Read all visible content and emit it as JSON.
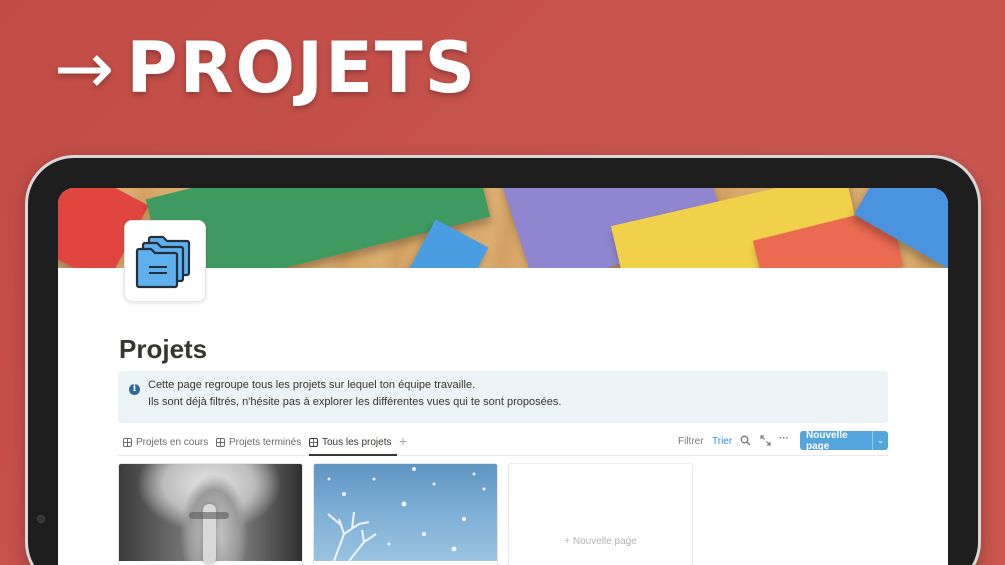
{
  "banner": {
    "arrow": "→",
    "title": "PROJETS"
  },
  "page": {
    "title": "Projets",
    "icon": "folders-icon"
  },
  "callout": {
    "icon": "info-icon",
    "line1": "Cette page regroupe tous les projets sur lequel ton équipe travaille.",
    "line2": "Ils sont déjà filtrés, n'hésite pas à explorer les différentes vues qui te sont proposées."
  },
  "views": {
    "tabs": [
      {
        "label": "Projets en cours",
        "active": false
      },
      {
        "label": "Projets terminés",
        "active": false
      },
      {
        "label": "Tous les projets",
        "active": true
      }
    ],
    "add": "+"
  },
  "toolbar": {
    "filter": "Filtrer",
    "sort": "Trier",
    "search_icon": "search-icon",
    "expand_icon": "expand-icon",
    "more": "···",
    "new_page": "Nouvelle page",
    "new_page_chevron": "⌄"
  },
  "gallery": {
    "cards": [
      {
        "image": "person-finger-on-lips-photo"
      },
      {
        "image": "snowy-tree-blue-sky-photo"
      }
    ],
    "add_card": {
      "icon": "+",
      "label": "Nouvelle page"
    }
  },
  "colors": {
    "background": "#c24b45",
    "accent": "#53a5dc",
    "callout": "#ecf3f6"
  }
}
